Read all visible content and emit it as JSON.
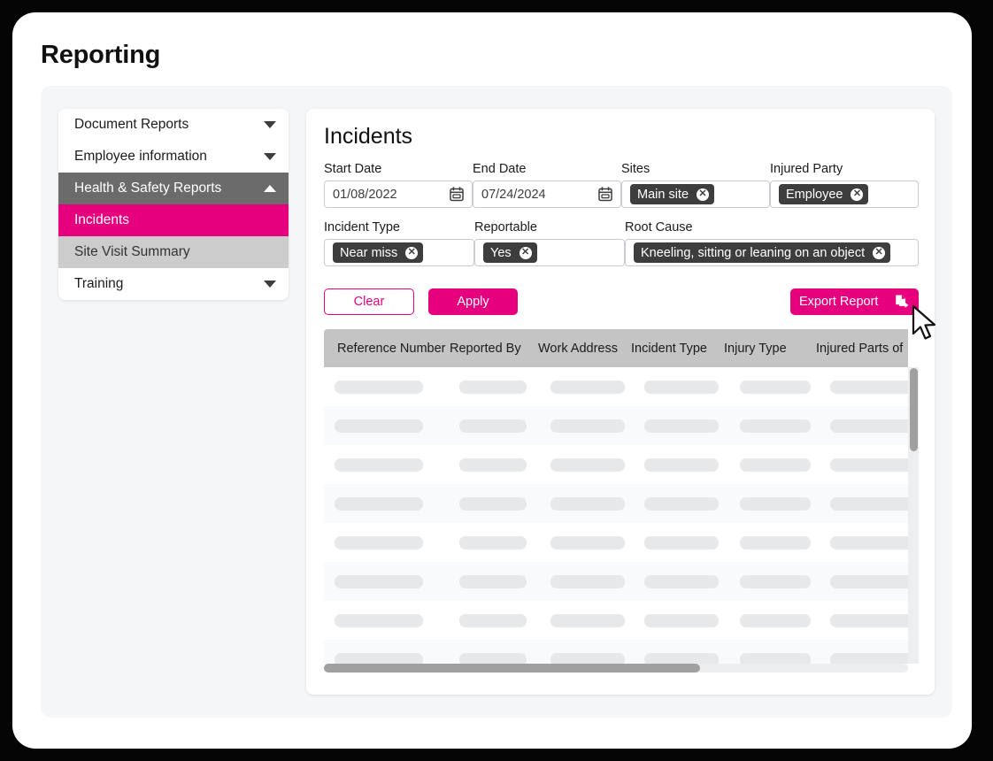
{
  "page": {
    "title": "Reporting"
  },
  "sidebar": {
    "items": [
      {
        "label": "Document Reports",
        "icon": "chevron-down-icon",
        "state": "collapsed"
      },
      {
        "label": "Employee information",
        "icon": "chevron-down-icon",
        "state": "collapsed"
      },
      {
        "label": "Health & Safety Reports",
        "icon": "chevron-up-icon",
        "state": "expanded"
      },
      {
        "label": "Incidents",
        "icon": "",
        "state": "active"
      },
      {
        "label": "Site Visit Summary",
        "icon": "",
        "state": "subdued"
      },
      {
        "label": "Training",
        "icon": "chevron-down-icon",
        "state": "collapsed"
      }
    ]
  },
  "main": {
    "heading": "Incidents",
    "filters": {
      "start_date": {
        "label": "Start Date",
        "value": "01/08/2022",
        "icon": "calendar-icon"
      },
      "end_date": {
        "label": "End Date",
        "value": "07/24/2024",
        "icon": "calendar-icon"
      },
      "sites": {
        "label": "Sites",
        "chip": "Main site"
      },
      "injured_party": {
        "label": "Injured Party",
        "chip": "Employee"
      },
      "incident_type": {
        "label": "Incident Type",
        "chip": "Near miss"
      },
      "reportable": {
        "label": "Reportable",
        "chip": "Yes"
      },
      "root_cause": {
        "label": "Root Cause",
        "chip": "Kneeling, sitting or leaning on an object"
      },
      "chip_remove": "✕"
    },
    "buttons": {
      "clear": "Clear",
      "apply": "Apply",
      "export": "Export Report",
      "export_icon": "document-export-icon"
    },
    "table": {
      "columns": [
        "Reference Number",
        "Reported By",
        "Work Address",
        "Incident Type",
        "Injury Type",
        "Injured Parts of"
      ],
      "row_state": "loading-skeleton",
      "row_count": 8
    }
  },
  "colors": {
    "accent": "#e6007e",
    "chip_background": "#3d3d3d",
    "nav_group_background": "#6b6b6b",
    "nav_subdued_background": "#cccccc",
    "table_header_background": "#c4c4c4",
    "panel_background": "#f4f6f8"
  }
}
